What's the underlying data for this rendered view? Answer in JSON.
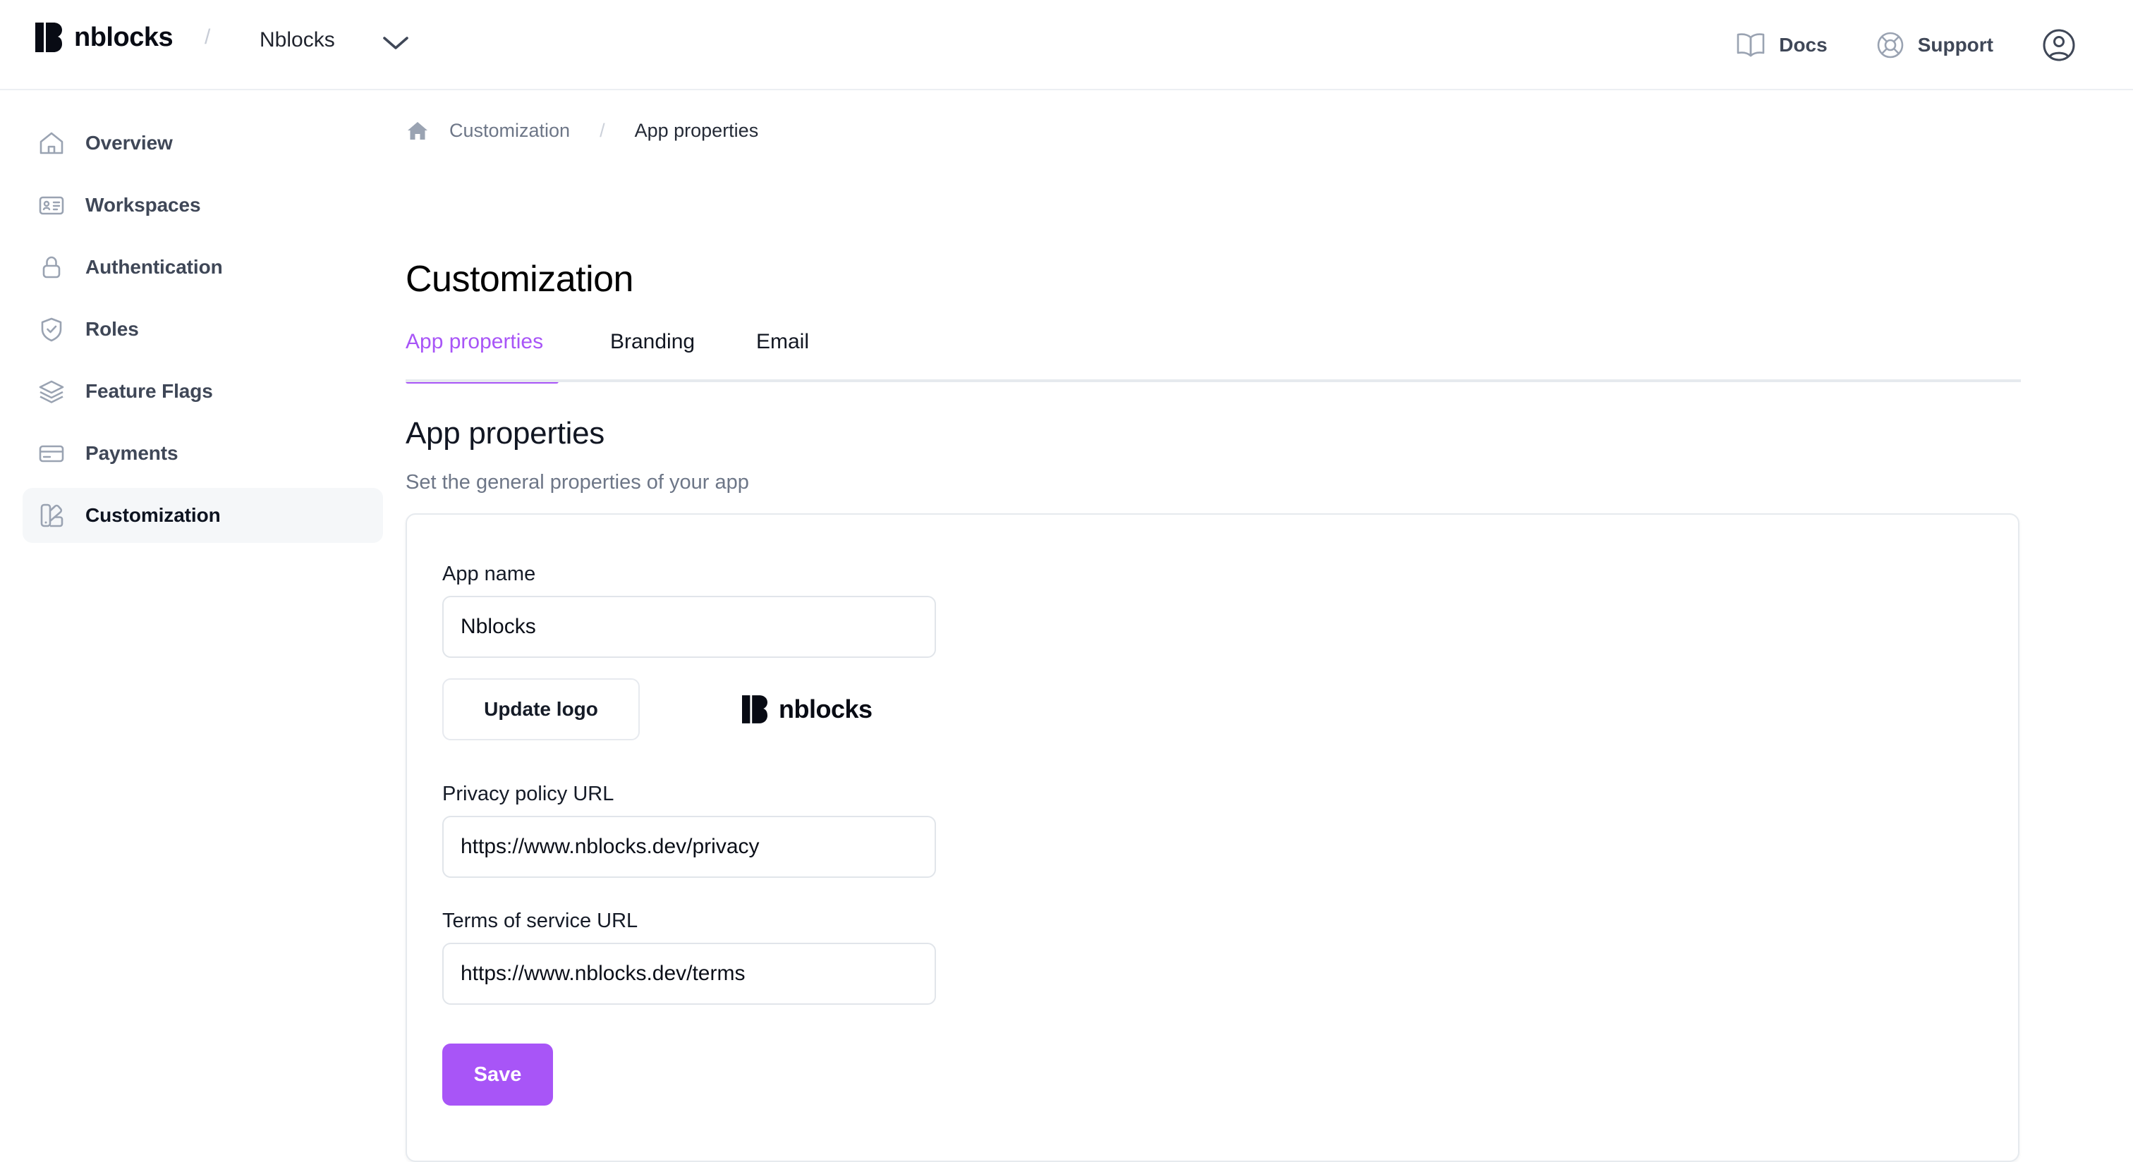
{
  "topbar": {
    "brand_name": "nblocks",
    "brand_logo_icon": "nblocks-logo-mark",
    "separator": "/",
    "tenant_name": "Nblocks",
    "tenant_chevron_icon": "chevron-down-icon",
    "docs_label": "Docs",
    "docs_icon": "book-icon",
    "support_label": "Support",
    "support_icon": "lifebuoy-icon",
    "account_icon": "user-circle-icon"
  },
  "sidebar": {
    "items": [
      {
        "label": "Overview",
        "icon": "home-icon",
        "active": false
      },
      {
        "label": "Workspaces",
        "icon": "id-card-icon",
        "active": false
      },
      {
        "label": "Authentication",
        "icon": "lock-icon",
        "active": false
      },
      {
        "label": "Roles",
        "icon": "shield-check-icon",
        "active": false
      },
      {
        "label": "Feature Flags",
        "icon": "layers-icon",
        "active": false
      },
      {
        "label": "Payments",
        "icon": "credit-card-icon",
        "active": false
      },
      {
        "label": "Customization",
        "icon": "color-swatch-icon",
        "active": true
      }
    ]
  },
  "breadcrumb": {
    "home_icon": "home-filled-icon",
    "parent": "Customization",
    "separator": "/",
    "current": "App properties"
  },
  "page": {
    "title": "Customization"
  },
  "tabs": [
    {
      "label": "App properties",
      "active": true
    },
    {
      "label": "Branding",
      "active": false
    },
    {
      "label": "Email",
      "active": false
    }
  ],
  "section": {
    "heading": "App properties",
    "subheading": "Set the general properties of your app"
  },
  "form": {
    "app_name": {
      "label": "App name",
      "value": "Nblocks",
      "placeholder": "App name"
    },
    "update_logo_button": "Update logo",
    "logo_preview_name": "nblocks",
    "logo_preview_icon": "nblocks-logo-mark",
    "privacy_policy": {
      "label": "Privacy policy URL",
      "value": "https://www.nblocks.dev/privacy",
      "placeholder": "Privacy policy URL"
    },
    "terms_of_service": {
      "label": "Terms of service URL",
      "value": "https://www.nblocks.dev/terms",
      "placeholder": "Terms of service URL"
    },
    "save_button": "Save"
  },
  "colors": {
    "accent": "#a855f7",
    "sidebar_active_bg": "#f5f7f9",
    "text_dark": "#0d1320",
    "text_muted": "#6d7687",
    "border": "#e6eaee"
  }
}
